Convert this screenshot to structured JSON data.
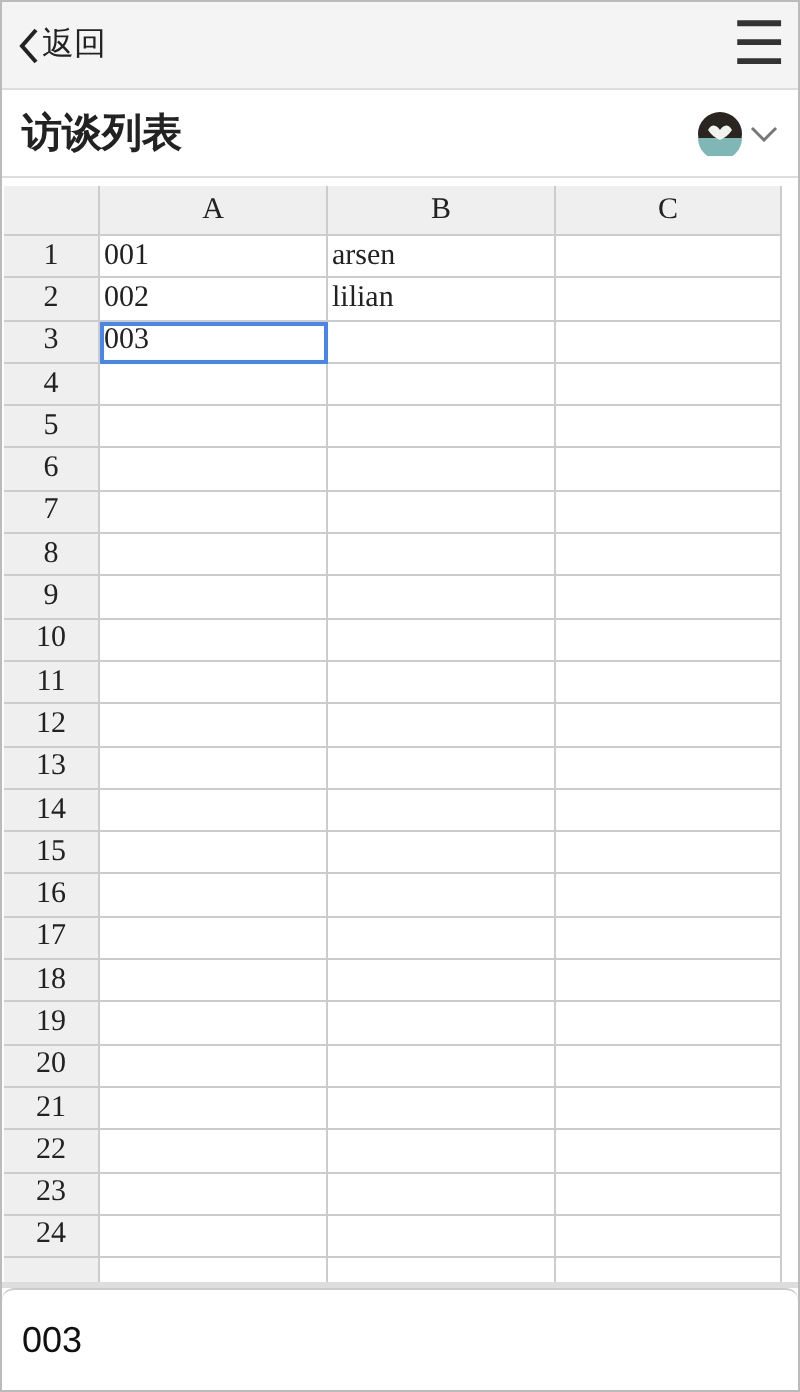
{
  "nav_bar": {
    "back": "返回",
    "menu": "☰"
  },
  "title_bar": {
    "title": "访谈列表"
  },
  "sheet": {
    "columns": [
      "A",
      "B",
      "C"
    ],
    "rows": [
      {
        "label": "1",
        "cells": [
          {
            "text": "001",
            "selected": false
          },
          {
            "text": "arsen",
            "selected": false
          },
          {
            "selected": false
          }
        ]
      },
      {
        "label": "2",
        "cells": [
          {
            "text": "002",
            "selected": false
          },
          {
            "text": "lilian",
            "selected": false
          },
          {
            "selected": false
          }
        ]
      },
      {
        "label": "3",
        "cells": [
          {
            "text": "003",
            "selected": true
          },
          {
            "selected": false
          },
          {
            "selected": false
          }
        ]
      },
      {
        "label": "4"
      },
      {
        "label": "5"
      },
      {
        "label": "6"
      },
      {
        "label": "7"
      },
      {
        "label": "8"
      },
      {
        "label": "9"
      },
      {
        "label": "10"
      },
      {
        "label": "11"
      },
      {
        "label": "12"
      },
      {
        "label": "13"
      },
      {
        "label": "14"
      },
      {
        "label": "15"
      },
      {
        "label": "16"
      },
      {
        "label": "17"
      },
      {
        "label": "18"
      },
      {
        "label": "19"
      },
      {
        "label": "20"
      },
      {
        "label": "21"
      },
      {
        "label": "22"
      },
      {
        "label": "23"
      },
      {
        "label": "24"
      }
    ]
  },
  "cell_editor": {
    "value": "003"
  }
}
